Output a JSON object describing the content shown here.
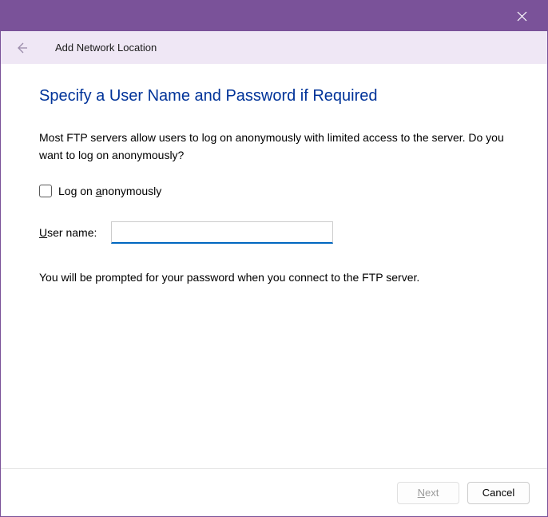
{
  "titlebar": {
    "close_icon": "close"
  },
  "header": {
    "back_icon": "back-arrow",
    "title": "Add Network Location"
  },
  "content": {
    "heading": "Specify a User Name and Password if Required",
    "description": "Most FTP servers allow users to log on anonymously with limited access to the server.  Do you want to log on anonymously?",
    "checkbox": {
      "label_prefix": "Log on ",
      "label_underline": "a",
      "label_rest": "nonymously",
      "checked": false
    },
    "username": {
      "label_underline": "U",
      "label_rest": "ser name:",
      "value": ""
    },
    "note": "You will be prompted for your password when you connect to the FTP server."
  },
  "footer": {
    "next_underline": "N",
    "next_rest": "ext",
    "cancel": "Cancel"
  }
}
